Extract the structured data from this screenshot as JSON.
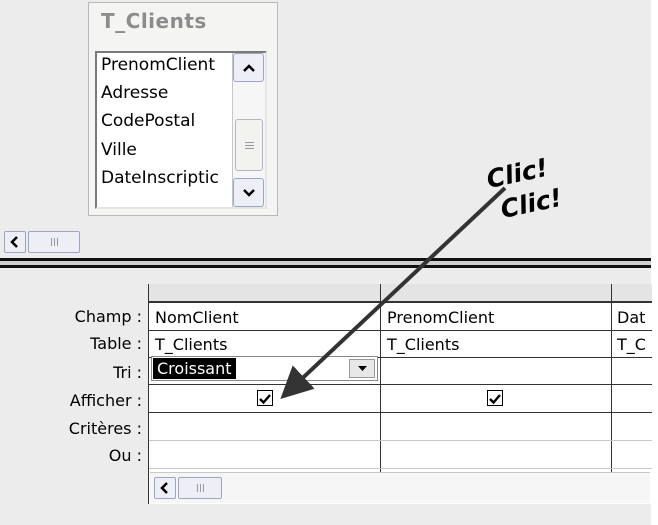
{
  "table_box": {
    "title": "T_Clients",
    "fields": [
      "PrenomClient",
      "Adresse",
      "CodePostal",
      "Ville",
      "DateInscriptic"
    ]
  },
  "row_labels": {
    "field": "Champ :",
    "table": "Table :",
    "sort": "Tri :",
    "show": "Afficher :",
    "criteria": "Critères :",
    "or": "Ou :"
  },
  "columns": [
    {
      "field": "NomClient",
      "table": "T_Clients",
      "sort": "Croissant",
      "show": true
    },
    {
      "field": "PrenomClient",
      "table": "T_Clients",
      "sort": "",
      "show": true
    },
    {
      "field": "Dat",
      "table": "T_C",
      "sort": "",
      "show": false
    }
  ],
  "annotation": {
    "line1": "Clic!",
    "line2": "Clic!"
  },
  "icons": {
    "scroll_up": "chevron-up-icon",
    "scroll_down": "chevron-down-icon",
    "scroll_left": "chevron-left-icon",
    "dropdown": "triangle-down-icon",
    "check": "checkmark-icon"
  }
}
